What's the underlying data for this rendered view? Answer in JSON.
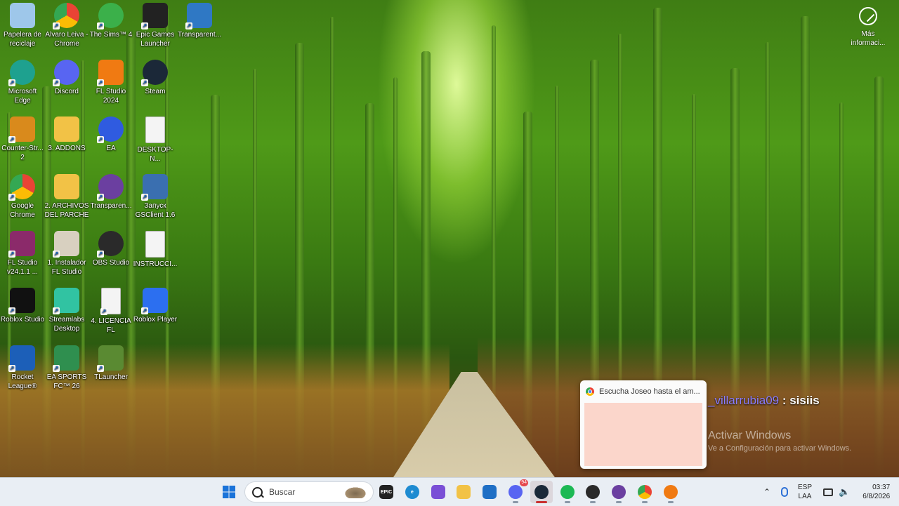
{
  "desktop": {
    "icons": [
      {
        "label": "Papelera de reciclaje",
        "icon": "recycle-bin-icon",
        "color": "#9ec7ea"
      },
      {
        "label": "Alvaro Leiva - Chrome",
        "icon": "chrome-icon",
        "color": "#4285f4"
      },
      {
        "label": "The Sims™ 4",
        "icon": "sims-icon",
        "color": "#3bb04a"
      },
      {
        "label": "Epic Games Launcher",
        "icon": "epic-games-icon",
        "color": "#222222"
      },
      {
        "label": "Transparent...",
        "icon": "window-icon",
        "color": "#2f78c4"
      },
      {
        "label": "Microsoft Edge",
        "icon": "edge-icon",
        "color": "#1ea18f"
      },
      {
        "label": "Discord",
        "icon": "discord-icon",
        "color": "#5865f2"
      },
      {
        "label": "FL Studio 2024",
        "icon": "fl-studio-icon",
        "color": "#f07a12"
      },
      {
        "label": "Steam",
        "icon": "steam-icon",
        "color": "#1b2838"
      },
      {
        "label": "Counter-Str... 2",
        "icon": "counter-strike-icon",
        "color": "#d98a1c"
      },
      {
        "label": "3. ADDONS",
        "icon": "folder-icon",
        "color": "#f2c246"
      },
      {
        "label": "EA",
        "icon": "ea-icon",
        "color": "#2f5be0"
      },
      {
        "label": "DESKTOP-N...",
        "icon": "text-file-icon",
        "color": "#f4f4f4"
      },
      {
        "label": "Google Chrome",
        "icon": "chrome-icon",
        "color": "#4285f4"
      },
      {
        "label": "2. ARCHIVOS DEL PARCHE",
        "icon": "folder-icon",
        "color": "#f2c246"
      },
      {
        "label": "Transparen...",
        "icon": "chat-bubble-icon",
        "color": "#6b3fa0"
      },
      {
        "label": "Запуск GSClient 1.6",
        "icon": "gsclient-icon",
        "color": "#3a6fb0"
      },
      {
        "label": "FL Studio v24.1.1 ...",
        "icon": "winrar-icon",
        "color": "#8b2a6a"
      },
      {
        "label": "1. Instalador FL Studio",
        "icon": "installer-icon",
        "color": "#d8d0c0"
      },
      {
        "label": "OBS Studio",
        "icon": "obs-icon",
        "color": "#2a2a2a"
      },
      {
        "label": "INSTRUCCI...",
        "icon": "text-file-icon",
        "color": "#f4f4f4"
      },
      {
        "label": "Roblox Studio",
        "icon": "roblox-studio-icon",
        "color": "#111111"
      },
      {
        "label": "Streamlabs Desktop",
        "icon": "streamlabs-icon",
        "color": "#31c3a2"
      },
      {
        "label": "4. LICENCIA FL",
        "icon": "license-file-icon",
        "color": "#f4f4f4"
      },
      {
        "label": "Roblox Player",
        "icon": "roblox-icon",
        "color": "#2c6ff0"
      },
      {
        "label": "Rocket League®",
        "icon": "rocket-league-icon",
        "color": "#1c5fb8"
      },
      {
        "label": "EA SPORTS FC™ 26",
        "icon": "fc26-icon",
        "color": "#2f8f4f"
      },
      {
        "label": "TLauncher",
        "icon": "tlauncher-icon",
        "color": "#5a8a32"
      }
    ],
    "more_info_label": "Más informaci..."
  },
  "notification": {
    "title": "Escucha Joseo hasta el am..."
  },
  "chat_overlay": {
    "username": "_villarrubia09",
    "message": " : sisiis"
  },
  "watermark": {
    "title": "Activar Windows",
    "subtitle": "Ve a Configuración para activar Windows."
  },
  "taskbar": {
    "search_placeholder": "Buscar",
    "apps": [
      {
        "name": "epic-games-icon",
        "text": "EPIC",
        "color": "#222222"
      },
      {
        "name": "edge-icon",
        "text": "e",
        "color": "#1e8bd1"
      },
      {
        "name": "copilot-icon",
        "text": "",
        "color": "#7a4fd6"
      },
      {
        "name": "file-explorer-icon",
        "text": "",
        "color": "#f2c246"
      },
      {
        "name": "store-icon",
        "text": "",
        "color": "#1f6fc5"
      },
      {
        "name": "discord-icon",
        "text": "",
        "color": "#5865f2",
        "badge": "94"
      },
      {
        "name": "steam-icon",
        "text": "",
        "color": "#1b2838"
      },
      {
        "name": "spotify-icon",
        "text": "",
        "color": "#1db954"
      },
      {
        "name": "obs-icon",
        "text": "",
        "color": "#2a2a2a"
      },
      {
        "name": "chat-bubble-icon",
        "text": "",
        "color": "#6b3fa0"
      },
      {
        "name": "chrome-icon",
        "text": "",
        "color": "#4285f4"
      },
      {
        "name": "fl-studio-icon",
        "text": "",
        "color": "#f07a12"
      }
    ],
    "language": "ESP",
    "layout": "LAA",
    "time": "03:37",
    "date": "6/8/2026"
  }
}
